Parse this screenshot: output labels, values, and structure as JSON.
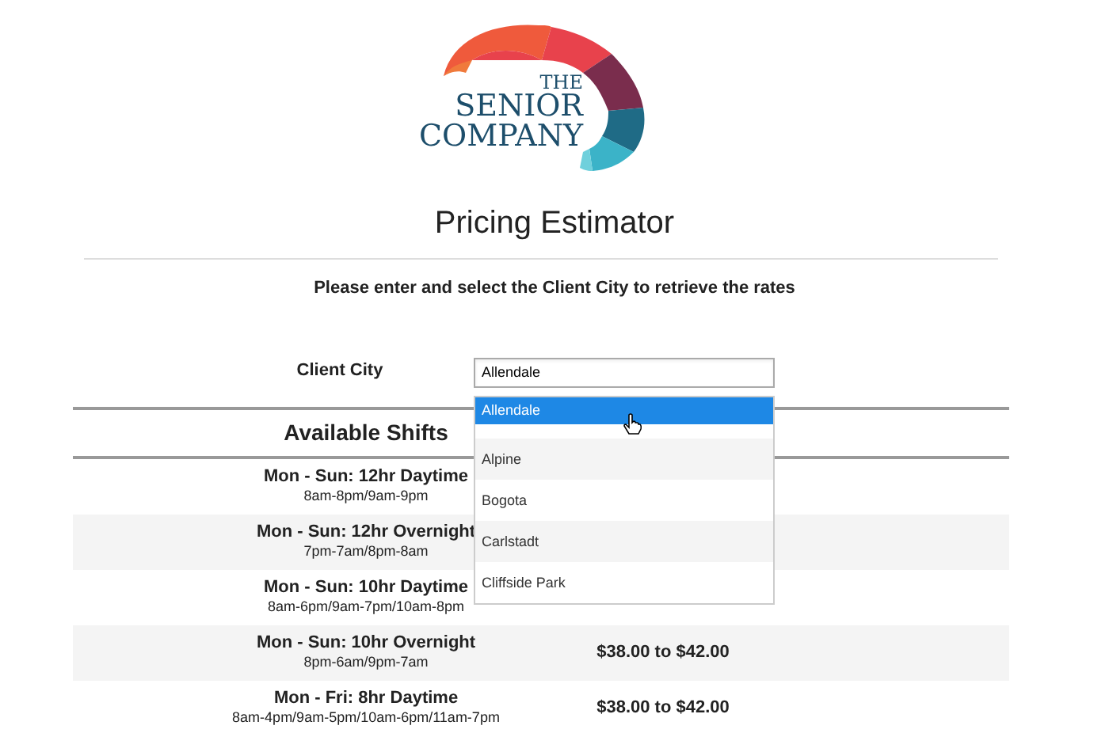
{
  "logo": {
    "lines": [
      "THE",
      "SENIOR",
      "COMPANY"
    ]
  },
  "title": "Pricing Estimator",
  "instruction": "Please enter and select the Client City to retrieve the rates",
  "client_city": {
    "label": "Client City",
    "value": "Allendale"
  },
  "suggestions": [
    {
      "label": "Allendale",
      "selected": true
    },
    {
      "label": "Alpine",
      "selected": false
    },
    {
      "label": "Bogota",
      "selected": false
    },
    {
      "label": "Carlstadt",
      "selected": false
    },
    {
      "label": "Cliffside Park",
      "selected": false
    }
  ],
  "shifts_heading": "Available Shifts",
  "shifts": [
    {
      "name": "Mon - Sun: 12hr Daytime",
      "hours": "8am-8pm/9am-9pm"
    },
    {
      "name": "Mon - Sun: 12hr Overnight",
      "hours": "7pm-7am/8pm-8am"
    },
    {
      "name": "Mon - Sun: 10hr Daytime",
      "hours": "8am-6pm/9am-7pm/10am-8pm"
    },
    {
      "name": "Mon - Sun: 10hr Overnight",
      "hours": "8pm-6am/9pm-7am",
      "price": "$38.00 to $42.00"
    },
    {
      "name": "Mon - Fri: 8hr Daytime",
      "hours": "8am-4pm/9am-5pm/10am-6pm/11am-7pm",
      "price": "$38.00 to $42.00"
    }
  ]
}
